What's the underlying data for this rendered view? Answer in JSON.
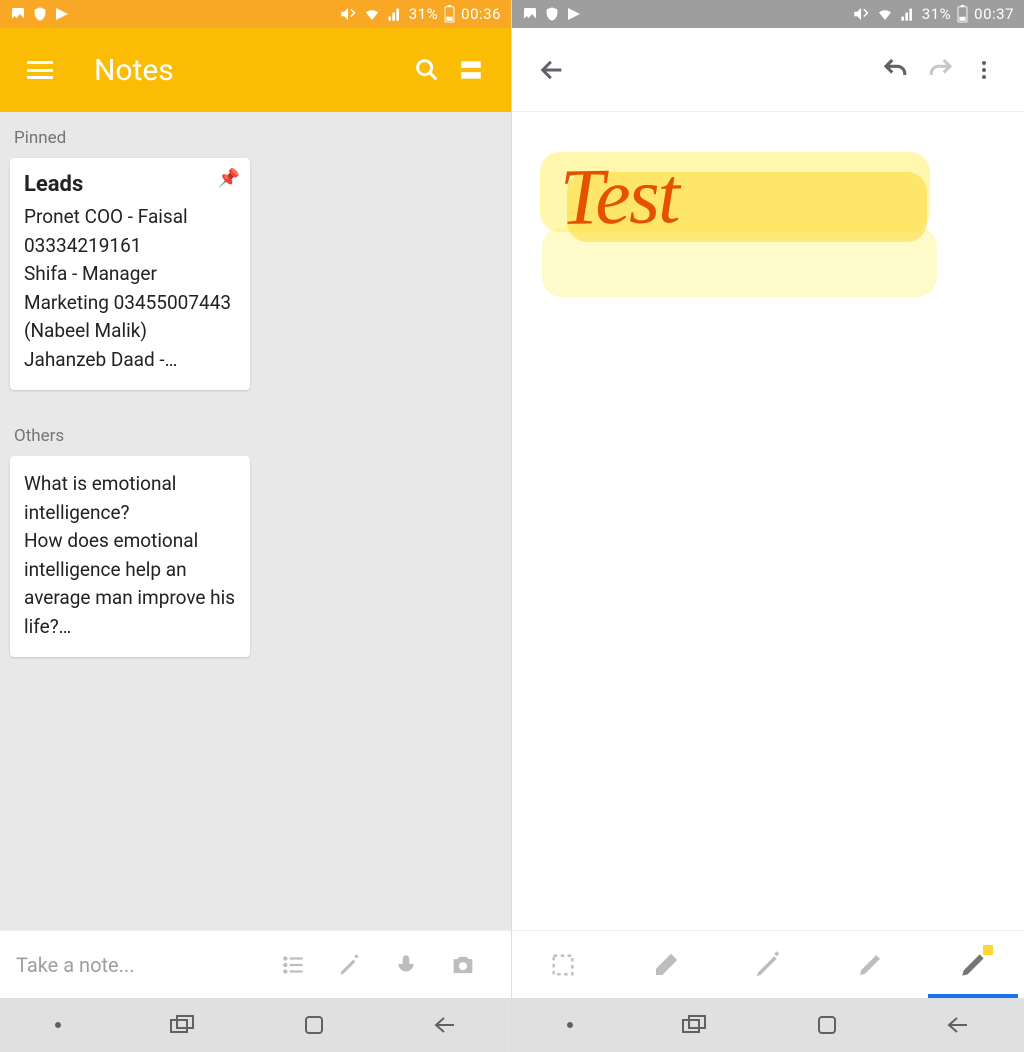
{
  "left": {
    "status": {
      "battery": "31%",
      "time": "00:36"
    },
    "appbar": {
      "title": "Notes"
    },
    "sections": {
      "pinned_label": "Pinned",
      "others_label": "Others"
    },
    "cards": {
      "pinned": {
        "title": "Leads",
        "body": "Pronet COO - Faisal 03334219161\nShifa - Manager Marketing 03455007443 (Nabeel Malik)\nJahanzeb Daad -…"
      },
      "other": {
        "body": "What is emotional intelligence?\nHow does emotional intelligence help an average man improve his life?…"
      }
    },
    "input_hint": "Take a note..."
  },
  "right": {
    "status": {
      "battery": "31%",
      "time": "00:37"
    },
    "drawing_text": "Test"
  },
  "colors": {
    "status_orange": "#F9A825",
    "appbar_orange": "#FBBC04",
    "status_grey": "#9E9E9E",
    "highlight": "#FFF176",
    "ink": "#E65100",
    "accent_blue": "#1A73E8"
  }
}
